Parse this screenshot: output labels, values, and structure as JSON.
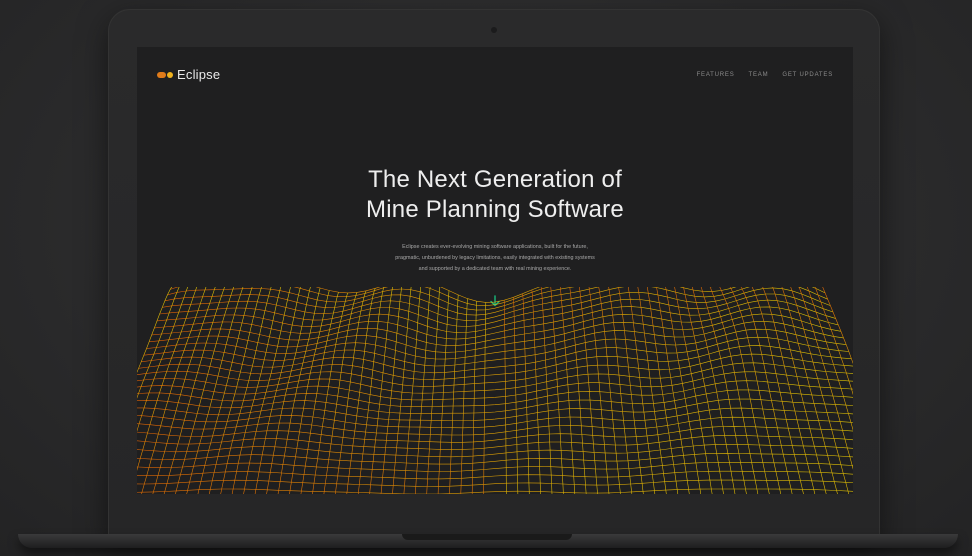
{
  "brand": {
    "name": "Eclipse",
    "colors": {
      "orange": "#e07b1a",
      "gold": "#f0b21e"
    }
  },
  "nav": {
    "items": [
      {
        "label": "FEATURES"
      },
      {
        "label": "TEAM"
      },
      {
        "label": "GET UPDATES"
      }
    ]
  },
  "hero": {
    "title_line1": "The Next Generation of",
    "title_line2": "Mine Planning Software",
    "body_line1": "Eclipse creates ever-evolving mining software applications, built for the future,",
    "body_line2": "pragmatic, unburdened by legacy limitations, easily integrated with existing systems",
    "body_line3": "and supported by a dedicated team with real mining experience.",
    "scroll_icon": "arrow-down-icon",
    "accent": "#18b87a"
  },
  "visual": {
    "terrain_colors": [
      "#ff6a00",
      "#ffb300",
      "#ffe000"
    ]
  }
}
